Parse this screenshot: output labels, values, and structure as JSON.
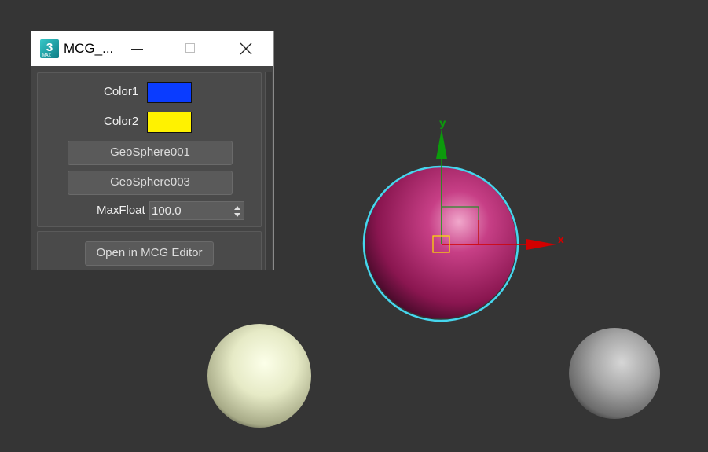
{
  "window": {
    "title": "MCG_..."
  },
  "controls": {
    "color1": {
      "label": "Color1",
      "value": "#0a3cff"
    },
    "color2": {
      "label": "Color2",
      "value": "#fff200"
    },
    "pick_button_1": "GeoSphere001",
    "pick_button_2": "GeoSphere003",
    "max_float": {
      "label": "MaxFloat",
      "value": "100.0"
    }
  },
  "footer": {
    "open_editor_label": "Open in MCG Editor"
  },
  "viewport": {
    "gizmo_y_label": "y",
    "gizmo_x_label": "x",
    "selected_sphere_color": "#c02474",
    "selection_outline_color": "#46d6ee",
    "left_sphere_color": "#f3f6da",
    "right_sphere_color": "#aaaaaa",
    "gizmo_y_color": "#0c9a0c",
    "gizmo_x_color": "#d20000"
  }
}
